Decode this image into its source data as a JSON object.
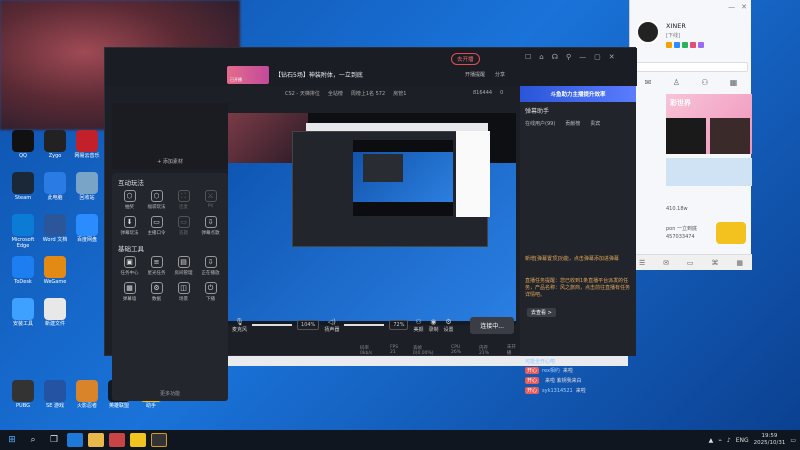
{
  "desktop_icons": [
    {
      "label": "QQ",
      "color": "#111"
    },
    {
      "label": "Zygo",
      "color": "#222"
    },
    {
      "label": "网易云音乐",
      "color": "#c2202a"
    },
    {
      "label": "Steam",
      "color": "#1b2838"
    },
    {
      "label": "此电脑",
      "color": "#2a7be4"
    },
    {
      "label": "回收站",
      "color": "#7aa3c8"
    },
    {
      "label": "Microsoft Edge",
      "color": "#0c7bd6"
    },
    {
      "label": "Word 文档",
      "color": "#2b579a"
    },
    {
      "label": "百度网盘",
      "color": "#2b8cff"
    },
    {
      "label": "ToDesk",
      "color": "#1c7ef0"
    },
    {
      "label": "WeGame",
      "color": "#e38a14"
    },
    {
      "label": "安装工具",
      "color": "#3ea0ff"
    },
    {
      "label": "新建文件",
      "color": "#e8e8e8"
    },
    {
      "label": "PUBG",
      "color": "#333"
    },
    {
      "label": "SE 游戏",
      "color": "#2553a4"
    },
    {
      "label": "火影忍者",
      "color": "#d9842a"
    },
    {
      "label": "英雄联盟",
      "color": "#0f1a24"
    },
    {
      "label": "助手",
      "color": "#f2c21b"
    }
  ],
  "chat_window": {
    "username": "XINER",
    "status": "[下线]",
    "banner_text": "彩世界",
    "num1": "410.18w",
    "num2": "457033474",
    "user_line": "pon 一立到底"
  },
  "main_window": {
    "live_badge": "去开播",
    "room_title": "【钻石5场】神装附体，一立到底",
    "room_avatar_caption": "已开播",
    "info_bar": {
      "category": "CS2 - 天梯排位",
      "items": [
        "全站榜",
        "周榜上1名 572",
        "房管1",
        "816444",
        "0"
      ]
    },
    "toolbar_right": [
      "开播提醒",
      "分享"
    ],
    "tool_sections": [
      {
        "title": "互动玩法",
        "items": [
          {
            "label": "抽奖",
            "glyph": "⬡",
            "dim": false
          },
          {
            "label": "福袋玩法",
            "glyph": "⬡",
            "dim": false
          },
          {
            "label": "连麦",
            "glyph": "⛶",
            "dim": true
          },
          {
            "label": "PK",
            "glyph": "⚔",
            "dim": true
          },
          {
            "label": "弹幕玩法",
            "glyph": "⬇",
            "dim": false
          },
          {
            "label": "主播口令",
            "glyph": "▭",
            "dim": false
          },
          {
            "label": "答题",
            "glyph": "▭",
            "dim": true
          },
          {
            "label": "弹幕点歌",
            "glyph": "⇩",
            "dim": false
          }
        ]
      },
      {
        "title": "基础工具",
        "items": [
          {
            "label": "任务中心",
            "glyph": "▣",
            "dim": false
          },
          {
            "label": "星光任务",
            "glyph": "≡",
            "dim": false
          },
          {
            "label": "房间管理",
            "glyph": "▤",
            "dim": false
          },
          {
            "label": "正在播放",
            "glyph": "⇩",
            "dim": false
          },
          {
            "label": "弹幕墙",
            "glyph": "▦",
            "dim": false
          },
          {
            "label": "数据",
            "glyph": "⚙",
            "dim": false
          },
          {
            "label": "场景",
            "glyph": "◫",
            "dim": false
          },
          {
            "label": "下播",
            "glyph": "⏻",
            "dim": false
          }
        ]
      }
    ],
    "add_source_label": "+ 添加素材",
    "more_label": "更多功能",
    "controls": {
      "mic_label": "麦克风",
      "mic_pct": "104%",
      "speaker_label": "扬声器",
      "speaker_pct": "72%",
      "beauty_label": "美颜",
      "record_label": "录制",
      "settings_label": "设置",
      "go_live_label": "连接中..."
    },
    "status": [
      "码率 0kb/s",
      "FPS 21",
      "丢帧 0(0.00%)",
      "CPU 26%",
      "内存 21%",
      "未开播"
    ],
    "side_panel": {
      "ad_text": "斗鱼助力主播提升效率",
      "title": "弹幕助手",
      "tabs": [
        "在线用户(99)",
        "贡献榜",
        "贵宾"
      ],
      "notice1": "新增[弹幕置顶]功能，点击弹幕添加进弹幕",
      "notice2": "直播任务提醒：您已收到1条直播平台派发的任务，产品名称：风之旅商，点击前往直播有任务详情吧。",
      "notice_link": "去查看 >",
      "open_tip": "可能全开心吧",
      "chat": [
        {
          "badge": "开心",
          "name": "rex相约",
          "text": "来啦"
        },
        {
          "badge": "开心",
          "name": "",
          "text": "来啦 紫钥我来白"
        },
        {
          "badge": "开心",
          "name": "syk1314521",
          "text": "来啦"
        }
      ]
    }
  },
  "taskbar": {
    "time": "19:59",
    "date": "2025/10/31",
    "lang": "ENG"
  }
}
